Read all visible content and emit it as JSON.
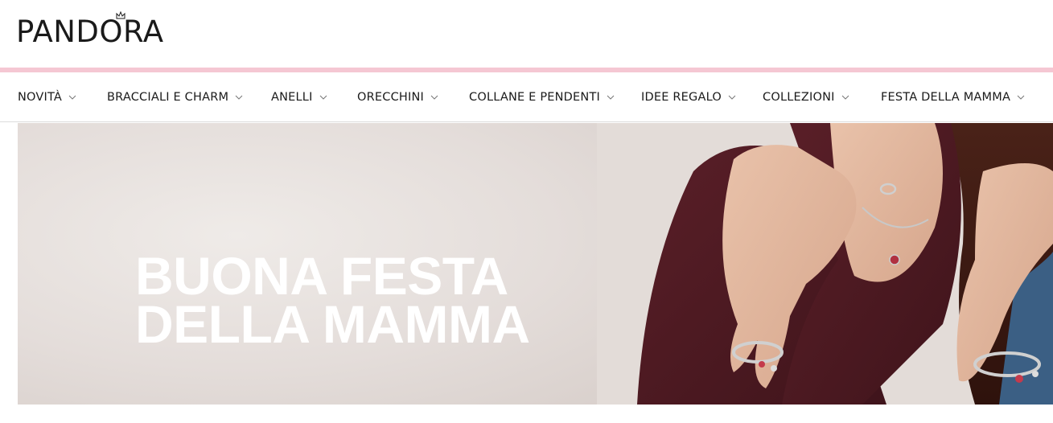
{
  "brand": {
    "name": "PANDORA",
    "accent_color": "#f5c7d3",
    "text_color": "#1a1a1a"
  },
  "nav": {
    "items": [
      {
        "label": "NOVITÀ",
        "icon": "chevron-down-icon"
      },
      {
        "label": "BRACCIALI E CHARM",
        "icon": "chevron-down-icon"
      },
      {
        "label": "ANELLI",
        "icon": "chevron-down-icon"
      },
      {
        "label": "ORECCHINI",
        "icon": "chevron-down-icon"
      },
      {
        "label": "COLLANE E PENDENTI",
        "icon": "chevron-down-icon"
      },
      {
        "label": "IDEE REGALO",
        "icon": "chevron-down-icon"
      },
      {
        "label": "COLLEZIONI",
        "icon": "chevron-down-icon"
      },
      {
        "label": "FESTA DELLA MAMMA",
        "icon": "chevron-down-icon"
      }
    ]
  },
  "hero": {
    "title_line1": "BUONA FESTA",
    "title_line2": "DELLA MAMMA",
    "title_color": "#ffffff"
  }
}
